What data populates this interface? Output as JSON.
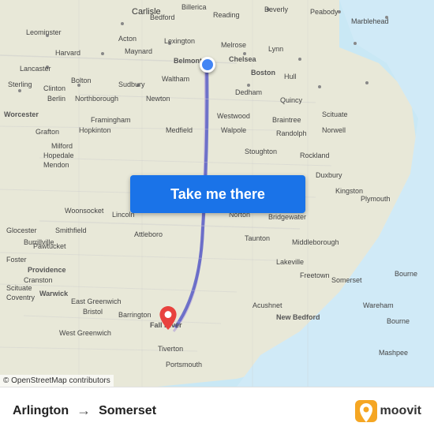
{
  "map": {
    "attribution": "© OpenStreetMap contributors",
    "center_label": "Carlisle",
    "route_line_color": "#5b5fc7",
    "pin_blue_color": "#4285f4",
    "pin_red_color": "#e8423e"
  },
  "button": {
    "label": "Take me there",
    "background_color": "#1a73e8",
    "text_color": "#ffffff"
  },
  "bottom_bar": {
    "from": "Arlington",
    "to": "Somerset",
    "arrow": "→",
    "logo_text": "moovit"
  }
}
